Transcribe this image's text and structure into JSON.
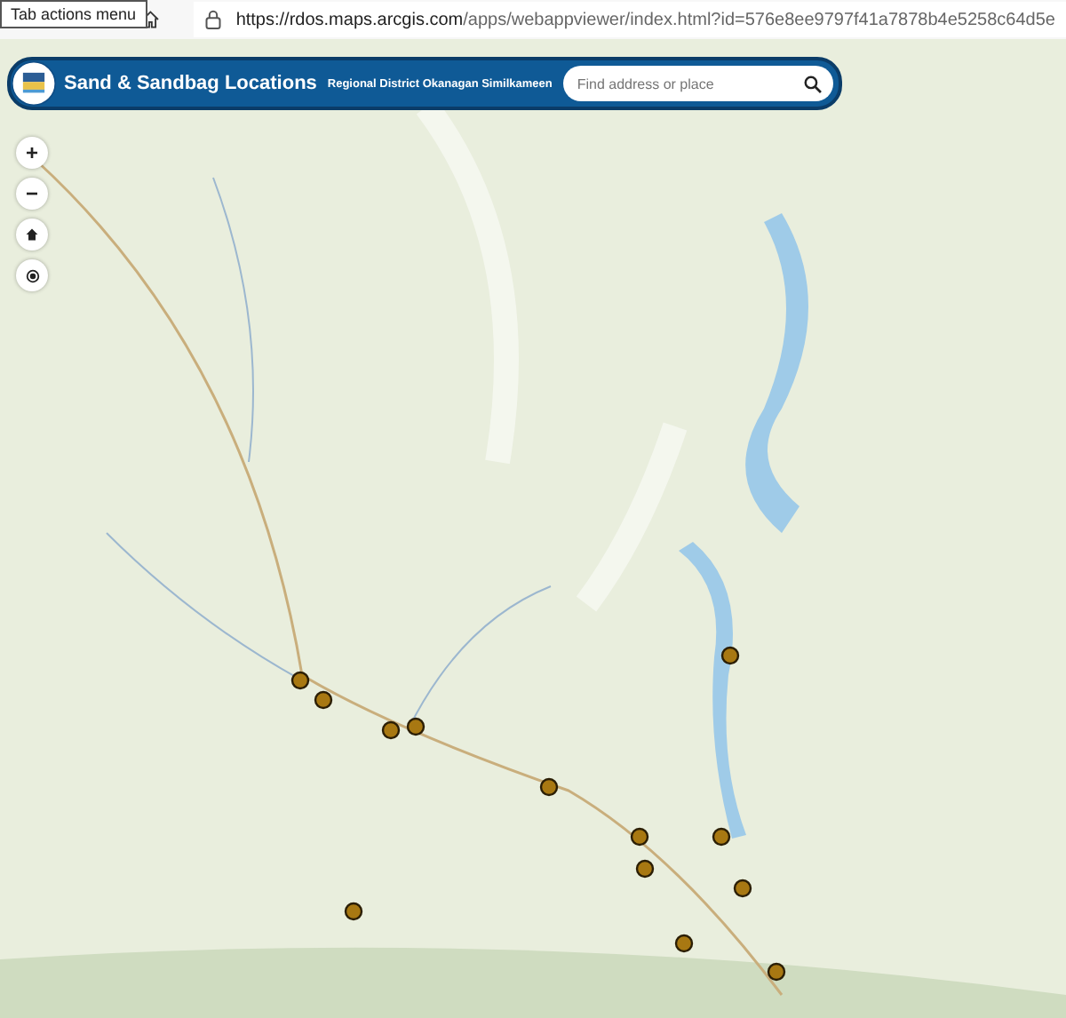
{
  "browser": {
    "tooltip": "Tab actions menu",
    "url_host": "https://rdos.maps.arcgis.com",
    "url_path": "/apps/webappviewer/index.html?id=576e8ee9797f41a7878b4e5258c64d5e"
  },
  "header": {
    "title": "Sand & Sandbag Locations",
    "subtitle": "Regional District Okanagan Similkameen",
    "search": {
      "placeholder": "Find address or place"
    }
  },
  "map_controls": [
    {
      "kind": "zoom-in",
      "label": "+"
    },
    {
      "kind": "zoom-out",
      "label": "−"
    },
    {
      "kind": "home"
    },
    {
      "kind": "locate"
    }
  ]
}
